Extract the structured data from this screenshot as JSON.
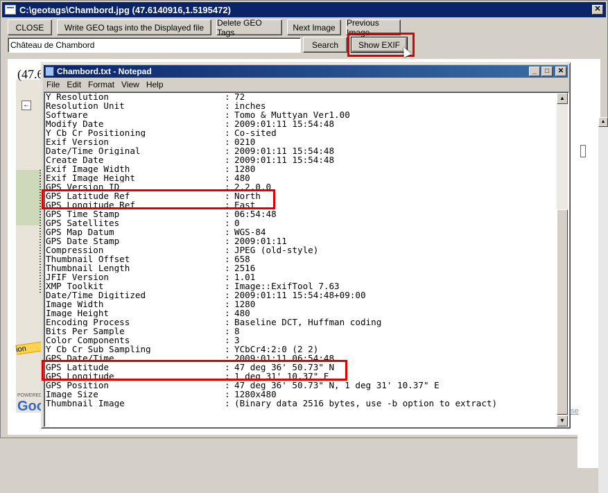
{
  "window": {
    "title": "C:\\geotags\\Chambord.jpg (47.6140916,1.5195472)"
  },
  "toolbar": {
    "close_label": "CLOSE",
    "write_label": "Write GEO tags into the Displayed file",
    "delete_label": "Delete GEO Tags",
    "next_label": "Next Image",
    "prev_label": "Previous Image",
    "search_label": "Search",
    "showexif_label": "Show EXIF"
  },
  "search": {
    "value": "Château de Chambord"
  },
  "map": {
    "coord_partial": "(47.6",
    "road_label": "ion",
    "powered_label": "POWERED",
    "logo": "Goo",
    "use_link": "se",
    "nav_left": "←"
  },
  "notepad": {
    "title": "Chambord.txt - Notepad",
    "menu": [
      "File",
      "Edit",
      "Format",
      "View",
      "Help"
    ],
    "lines": [
      {
        "k": "Y Resolution",
        "v": "72"
      },
      {
        "k": "Resolution Unit",
        "v": "inches"
      },
      {
        "k": "Software",
        "v": "Tomo & Muttyan Ver1.00"
      },
      {
        "k": "Modify Date",
        "v": "2009:01:11 15:54:48"
      },
      {
        "k": "Y Cb Cr Positioning",
        "v": "Co-sited"
      },
      {
        "k": "Exif Version",
        "v": "0210"
      },
      {
        "k": "Date/Time Original",
        "v": "2009:01:11 15:54:48"
      },
      {
        "k": "Create Date",
        "v": "2009:01:11 15:54:48"
      },
      {
        "k": "Exif Image Width",
        "v": "1280"
      },
      {
        "k": "Exif Image Height",
        "v": "480"
      },
      {
        "k": "GPS Version ID",
        "v": "2.2.0.0"
      },
      {
        "k": "GPS Latitude Ref",
        "v": "North"
      },
      {
        "k": "GPS Longitude Ref",
        "v": "East"
      },
      {
        "k": "GPS Time Stamp",
        "v": "06:54:48"
      },
      {
        "k": "GPS Satellites",
        "v": "0"
      },
      {
        "k": "GPS Map Datum",
        "v": "WGS-84"
      },
      {
        "k": "GPS Date Stamp",
        "v": "2009:01:11"
      },
      {
        "k": "Compression",
        "v": "JPEG (old-style)"
      },
      {
        "k": "Thumbnail Offset",
        "v": "658"
      },
      {
        "k": "Thumbnail Length",
        "v": "2516"
      },
      {
        "k": "JFIF Version",
        "v": "1.01"
      },
      {
        "k": "XMP Toolkit",
        "v": "Image::ExifTool 7.63"
      },
      {
        "k": "Date/Time Digitized",
        "v": "2009:01:11 15:54:48+09:00"
      },
      {
        "k": "Image Width",
        "v": "1280"
      },
      {
        "k": "Image Height",
        "v": "480"
      },
      {
        "k": "Encoding Process",
        "v": "Baseline DCT, Huffman coding"
      },
      {
        "k": "Bits Per Sample",
        "v": "8"
      },
      {
        "k": "Color Components",
        "v": "3"
      },
      {
        "k": "Y Cb Cr Sub Sampling",
        "v": "YCbCr4:2:0 (2 2)"
      },
      {
        "k": "GPS Date/Time",
        "v": "2009:01:11 06:54:48"
      },
      {
        "k": "GPS Latitude",
        "v": "47 deg 36' 50.73\" N"
      },
      {
        "k": "GPS Longitude",
        "v": "1 deg 31' 10.37\" E"
      },
      {
        "k": "GPS Position",
        "v": "47 deg 36' 50.73\" N, 1 deg 31' 10.37\" E"
      },
      {
        "k": "Image Size",
        "v": "1280x480"
      },
      {
        "k": "Thumbnail Image",
        "v": "(Binary data 2516 bytes, use -b option to extract)"
      }
    ],
    "separator": ":"
  },
  "colors": {
    "title_bar": "#0a246a",
    "highlight": "#e00000"
  }
}
